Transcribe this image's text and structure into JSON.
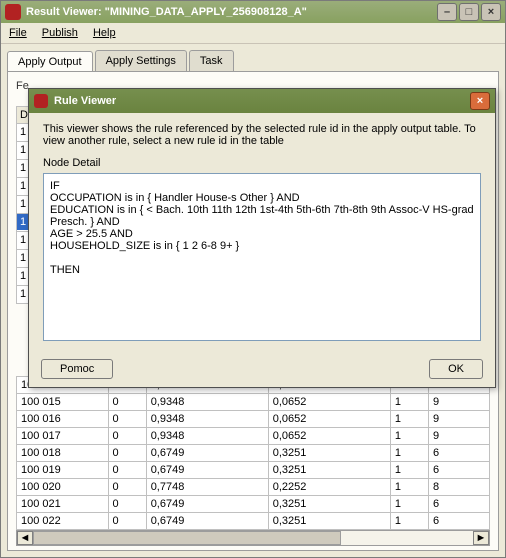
{
  "window": {
    "title": "Result Viewer: \"MINING_DATA_APPLY_256908128_A\"",
    "menu": {
      "file": "File",
      "publish": "Publish",
      "help": "Help"
    }
  },
  "tabs": {
    "apply_output": "Apply Output",
    "apply_settings": "Apply Settings",
    "task": "Task"
  },
  "body": {
    "partial_label_prefix": "Fe",
    "left_header": "D",
    "left_values": [
      "1",
      "1",
      "1",
      "1",
      "1",
      "1",
      "1",
      "1",
      "1",
      "1"
    ]
  },
  "grid": {
    "rows": [
      {
        "c0": "100 014",
        "c1": "0",
        "c2": "0,9348",
        "c3": "0,0652",
        "c4": "1",
        "c5": "9"
      },
      {
        "c0": "100 015",
        "c1": "0",
        "c2": "0,9348",
        "c3": "0,0652",
        "c4": "1",
        "c5": "9"
      },
      {
        "c0": "100 016",
        "c1": "0",
        "c2": "0,9348",
        "c3": "0,0652",
        "c4": "1",
        "c5": "9"
      },
      {
        "c0": "100 017",
        "c1": "0",
        "c2": "0,9348",
        "c3": "0,0652",
        "c4": "1",
        "c5": "9"
      },
      {
        "c0": "100 018",
        "c1": "0",
        "c2": "0,6749",
        "c3": "0,3251",
        "c4": "1",
        "c5": "6"
      },
      {
        "c0": "100 019",
        "c1": "0",
        "c2": "0,6749",
        "c3": "0,3251",
        "c4": "1",
        "c5": "6"
      },
      {
        "c0": "100 020",
        "c1": "0",
        "c2": "0,7748",
        "c3": "0,2252",
        "c4": "1",
        "c5": "8"
      },
      {
        "c0": "100 021",
        "c1": "0",
        "c2": "0,6749",
        "c3": "0,3251",
        "c4": "1",
        "c5": "6"
      },
      {
        "c0": "100 022",
        "c1": "0",
        "c2": "0,6749",
        "c3": "0,3251",
        "c4": "1",
        "c5": "6"
      }
    ]
  },
  "dialog": {
    "title": "Rule Viewer",
    "intro": "This viewer shows the rule referenced by the selected rule id in the apply output table.  To view another rule, select a new rule id in the table",
    "node_label": "Node Detail",
    "rule_text": "IF\nOCCUPATION is in { Handler House-s Other } AND\nEDUCATION is in { < Bach. 10th 11th 12th 1st-4th 5th-6th 7th-8th 9th Assoc-V HS-grad Presch. } AND\nAGE > 25.5 AND\nHOUSEHOLD_SIZE is in { 1 2 6-8 9+ }\n\nTHEN",
    "help_btn": "Pomoc",
    "ok_btn": "OK"
  }
}
